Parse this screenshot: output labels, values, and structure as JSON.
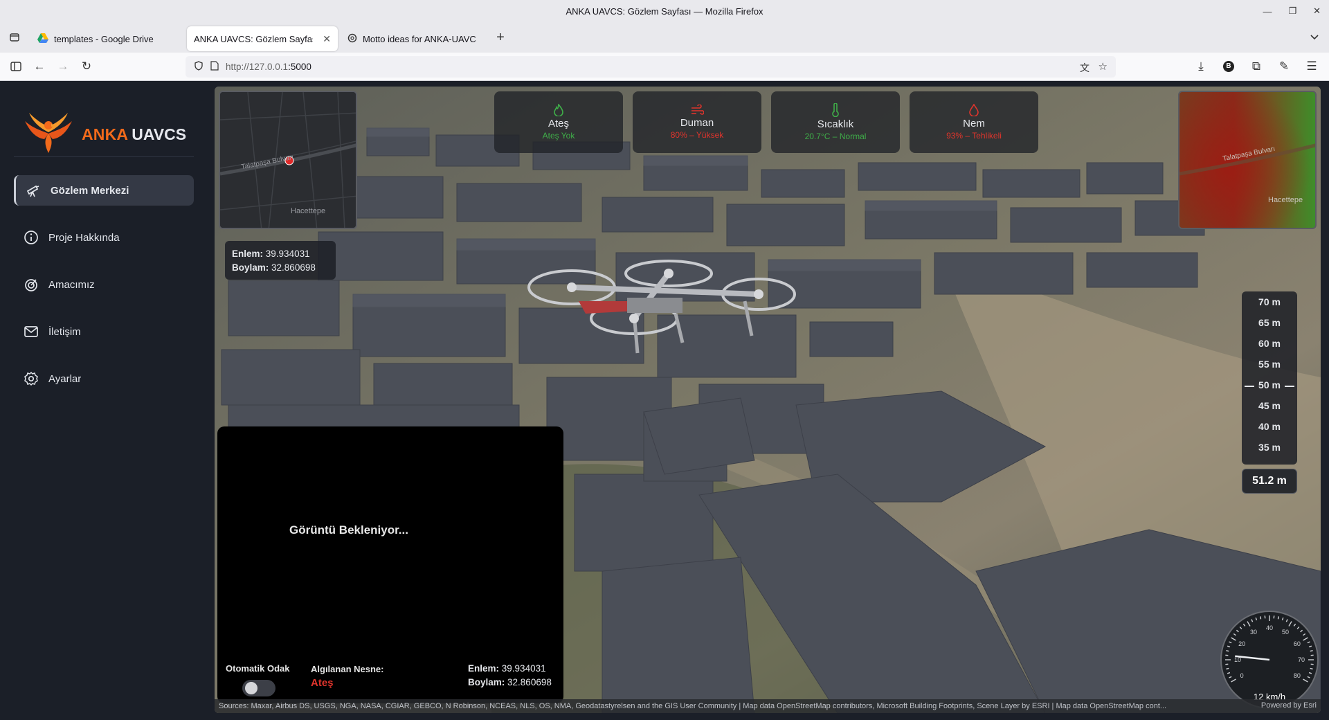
{
  "browser": {
    "window_title": "ANKA UAVCS: Gözlem Sayfası — Mozilla Firefox",
    "tabs": [
      {
        "title": "templates - Google Drive",
        "icon": "google-drive-icon"
      },
      {
        "title": "ANKA UAVCS: Gözlem Sayfası",
        "icon": "none",
        "active": true
      },
      {
        "title": "Motto ideas for ANKA-UAVC",
        "icon": "chatgpt-icon"
      }
    ],
    "url_host": "http://127.0.0.1",
    "url_port": ":5000"
  },
  "app": {
    "brand_primary": "ANKA",
    "brand_secondary": "UAVCS",
    "brand_color": "#f26a1b",
    "nav": [
      {
        "label": "Gözlem Merkezi",
        "icon": "telescope-icon",
        "active": true
      },
      {
        "label": "Proje Hakkında",
        "icon": "info-icon"
      },
      {
        "label": "Amacımız",
        "icon": "target-icon"
      },
      {
        "label": "İletişim",
        "icon": "mail-icon"
      },
      {
        "label": "Ayarlar",
        "icon": "gear-icon"
      }
    ]
  },
  "sensors": [
    {
      "name": "Ateş",
      "status": "Ateş Yok",
      "color": "#3fae49",
      "icon": "flame-icon"
    },
    {
      "name": "Duman",
      "status": "80% – Yüksek",
      "color": "#e0342c",
      "icon": "wind-icon"
    },
    {
      "name": "Sıcaklık",
      "status": "20.7°C – Normal",
      "color": "#3fae49",
      "icon": "thermometer-icon"
    },
    {
      "name": "Nem",
      "status": "93% – Tehlikeli",
      "color": "#e0342c",
      "icon": "droplet-icon"
    }
  ],
  "minimap": {
    "street": "Talatpaşa Bulvarı",
    "district": "Hacettepe"
  },
  "position": {
    "lat_label": "Enlem:",
    "lat": "39.934031",
    "lon_label": "Boylam:",
    "lon": "32.860698"
  },
  "altimeter": {
    "ticks": [
      "70 m",
      "65 m",
      "60 m",
      "55 m",
      "50 m",
      "45 m",
      "40 m",
      "35 m"
    ],
    "current": "51.2 m"
  },
  "camera": {
    "waiting_text": "Görüntü Bekleniyor...",
    "autofocus_label": "Otomatik Odak",
    "autofocus_on": false,
    "detected_label": "Algılanan Nesne:",
    "detected_value": "Ateş",
    "detected_color": "#e0342c"
  },
  "speed": {
    "ticks": [
      "0",
      "10",
      "20",
      "30",
      "40",
      "50",
      "60",
      "70",
      "80"
    ],
    "readout": "12 km/h",
    "value_kmh": 12
  },
  "attribution": {
    "sources": "Sources: Maxar, Airbus DS, USGS, NGA, NASA, CGIAR, GEBCO, N Robinson, NCEAS, NLS, OS, NMA, Geodatastyrelsen and the GIS User Community | Map data OpenStreetMap contributors, Microsoft Building Footprints, Scene Layer by ESRI | Map data OpenStreetMap cont...",
    "powered": "Powered by Esri"
  }
}
